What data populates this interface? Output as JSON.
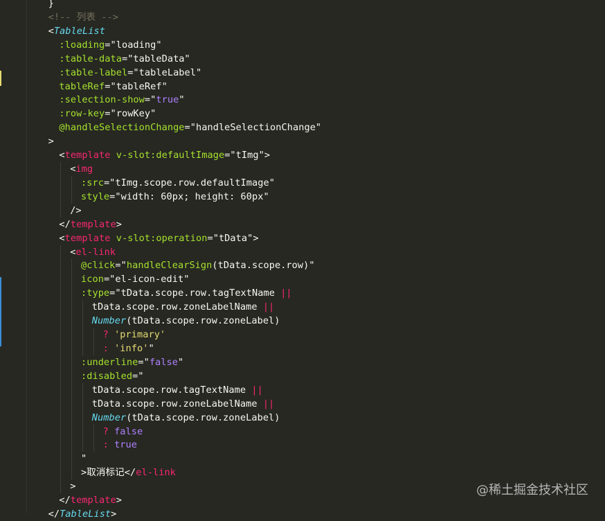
{
  "theme": {
    "background": "#272822",
    "gutter_mark_modified": "#e6db74",
    "gutter_mark_added": "#3a8fd6"
  },
  "watermark": "@稀土掘金技术社区",
  "code_lines": [
    {
      "indent": 2,
      "tokens": [
        {
          "t": "}",
          "c": "punc"
        }
      ]
    },
    {
      "indent": 2,
      "tokens": [
        {
          "t": "<!-- 列表 -->",
          "c": "comment"
        }
      ]
    },
    {
      "indent": 2,
      "tokens": [
        {
          "t": "<",
          "c": "punc"
        },
        {
          "t": "TableList",
          "c": "comp"
        }
      ]
    },
    {
      "indent": 3,
      "tokens": [
        {
          "t": ":loading",
          "c": "attr"
        },
        {
          "t": "=\"loading\"",
          "c": "str"
        }
      ]
    },
    {
      "indent": 3,
      "tokens": [
        {
          "t": ":table-data",
          "c": "attr"
        },
        {
          "t": "=\"tableData\"",
          "c": "str"
        }
      ]
    },
    {
      "indent": 3,
      "tokens": [
        {
          "t": ":table-label",
          "c": "attr"
        },
        {
          "t": "=\"tableLabel\"",
          "c": "str"
        }
      ]
    },
    {
      "indent": 3,
      "tokens": [
        {
          "t": "tableRef",
          "c": "attr"
        },
        {
          "t": "=\"tableRef\"",
          "c": "str"
        }
      ]
    },
    {
      "indent": 3,
      "tokens": [
        {
          "t": ":selection-show",
          "c": "attr"
        },
        {
          "t": "=\"",
          "c": "str"
        },
        {
          "t": "true",
          "c": "const"
        },
        {
          "t": "\"",
          "c": "str"
        }
      ]
    },
    {
      "indent": 3,
      "tokens": [
        {
          "t": ":row-key",
          "c": "attr"
        },
        {
          "t": "=\"rowKey\"",
          "c": "str"
        }
      ]
    },
    {
      "indent": 3,
      "tokens": [
        {
          "t": "@handleSelectionChange",
          "c": "attr"
        },
        {
          "t": "=\"handleSelectionChange\"",
          "c": "str"
        }
      ]
    },
    {
      "indent": 2,
      "tokens": [
        {
          "t": ">",
          "c": "punc"
        }
      ]
    },
    {
      "indent": 3,
      "tokens": [
        {
          "t": "<",
          "c": "punc"
        },
        {
          "t": "template",
          "c": "tag"
        },
        {
          "t": " v-slot:defaultImage",
          "c": "attr"
        },
        {
          "t": "=\"tImg\">",
          "c": "str"
        }
      ]
    },
    {
      "indent": 4,
      "tokens": [
        {
          "t": "<",
          "c": "punc"
        },
        {
          "t": "img",
          "c": "tag"
        }
      ]
    },
    {
      "indent": 5,
      "tokens": [
        {
          "t": ":src",
          "c": "attr"
        },
        {
          "t": "=\"tImg.scope.row.defaultImage\"",
          "c": "str"
        }
      ]
    },
    {
      "indent": 5,
      "tokens": [
        {
          "t": "style",
          "c": "attr"
        },
        {
          "t": "=\"width: 60px; height: 60px\"",
          "c": "str"
        }
      ]
    },
    {
      "indent": 4,
      "tokens": [
        {
          "t": "/>",
          "c": "punc"
        }
      ]
    },
    {
      "indent": 3,
      "tokens": [
        {
          "t": "</",
          "c": "punc"
        },
        {
          "t": "template",
          "c": "tag"
        },
        {
          "t": ">",
          "c": "punc"
        }
      ]
    },
    {
      "indent": 3,
      "tokens": [
        {
          "t": "<",
          "c": "punc"
        },
        {
          "t": "template",
          "c": "tag"
        },
        {
          "t": " v-slot:operation",
          "c": "attr"
        },
        {
          "t": "=\"tData\">",
          "c": "str"
        }
      ]
    },
    {
      "indent": 4,
      "tokens": [
        {
          "t": "<",
          "c": "punc"
        },
        {
          "t": "el-link",
          "c": "tag"
        }
      ]
    },
    {
      "indent": 5,
      "tokens": [
        {
          "t": "@click",
          "c": "attr"
        },
        {
          "t": "=\"",
          "c": "str"
        },
        {
          "t": "handleClearSign",
          "c": "attr"
        },
        {
          "t": "(tData.scope.row)\"",
          "c": "str"
        }
      ]
    },
    {
      "indent": 5,
      "tokens": [
        {
          "t": "icon",
          "c": "attr"
        },
        {
          "t": "=\"el-icon-edit\"",
          "c": "str"
        }
      ]
    },
    {
      "indent": 5,
      "tokens": [
        {
          "t": ":type",
          "c": "attr"
        },
        {
          "t": "=\"tData.scope.row.tagTextName ",
          "c": "str"
        },
        {
          "t": "||",
          "c": "op"
        }
      ]
    },
    {
      "indent": 6,
      "tokens": [
        {
          "t": "tData.scope.row.zoneLabelName ",
          "c": "str"
        },
        {
          "t": "||",
          "c": "op"
        }
      ]
    },
    {
      "indent": 6,
      "tokens": [
        {
          "t": "Number",
          "c": "comp"
        },
        {
          "t": "(tData.scope.row.zoneLabel)",
          "c": "str"
        }
      ]
    },
    {
      "indent": 7,
      "tokens": [
        {
          "t": "? ",
          "c": "op"
        },
        {
          "t": "'primary'",
          "c": "yel"
        }
      ]
    },
    {
      "indent": 7,
      "tokens": [
        {
          "t": ": ",
          "c": "op"
        },
        {
          "t": "'info'",
          "c": "yel"
        },
        {
          "t": "\"",
          "c": "str"
        }
      ]
    },
    {
      "indent": 5,
      "tokens": [
        {
          "t": ":underline",
          "c": "attr"
        },
        {
          "t": "=\"",
          "c": "str"
        },
        {
          "t": "false",
          "c": "const"
        },
        {
          "t": "\"",
          "c": "str"
        }
      ]
    },
    {
      "indent": 5,
      "tokens": [
        {
          "t": ":disabled",
          "c": "attr"
        },
        {
          "t": "=\"",
          "c": "str"
        }
      ]
    },
    {
      "indent": 6,
      "tokens": [
        {
          "t": "tData.scope.row.tagTextName ",
          "c": "str"
        },
        {
          "t": "||",
          "c": "op"
        }
      ]
    },
    {
      "indent": 6,
      "tokens": [
        {
          "t": "tData.scope.row.zoneLabelName ",
          "c": "str"
        },
        {
          "t": "||",
          "c": "op"
        }
      ]
    },
    {
      "indent": 6,
      "tokens": [
        {
          "t": "Number",
          "c": "comp"
        },
        {
          "t": "(tData.scope.row.zoneLabel)",
          "c": "str"
        }
      ]
    },
    {
      "indent": 7,
      "tokens": [
        {
          "t": "? ",
          "c": "op"
        },
        {
          "t": "false",
          "c": "const"
        }
      ]
    },
    {
      "indent": 7,
      "tokens": [
        {
          "t": ": ",
          "c": "op"
        },
        {
          "t": "true",
          "c": "const"
        }
      ]
    },
    {
      "indent": 5,
      "tokens": [
        {
          "t": "\"",
          "c": "str"
        }
      ]
    },
    {
      "indent": 5,
      "tokens": [
        {
          "t": ">取消标记</",
          "c": "text"
        },
        {
          "t": "el-link",
          "c": "tag"
        }
      ]
    },
    {
      "indent": 4,
      "tokens": [
        {
          "t": ">",
          "c": "punc"
        }
      ]
    },
    {
      "indent": 3,
      "tokens": [
        {
          "t": "</",
          "c": "punc"
        },
        {
          "t": "template",
          "c": "tag"
        },
        {
          "t": ">",
          "c": "punc"
        }
      ]
    },
    {
      "indent": 2,
      "tokens": [
        {
          "t": "</",
          "c": "punc"
        },
        {
          "t": "TableList",
          "c": "comp"
        },
        {
          "t": ">",
          "c": "punc"
        }
      ]
    }
  ]
}
